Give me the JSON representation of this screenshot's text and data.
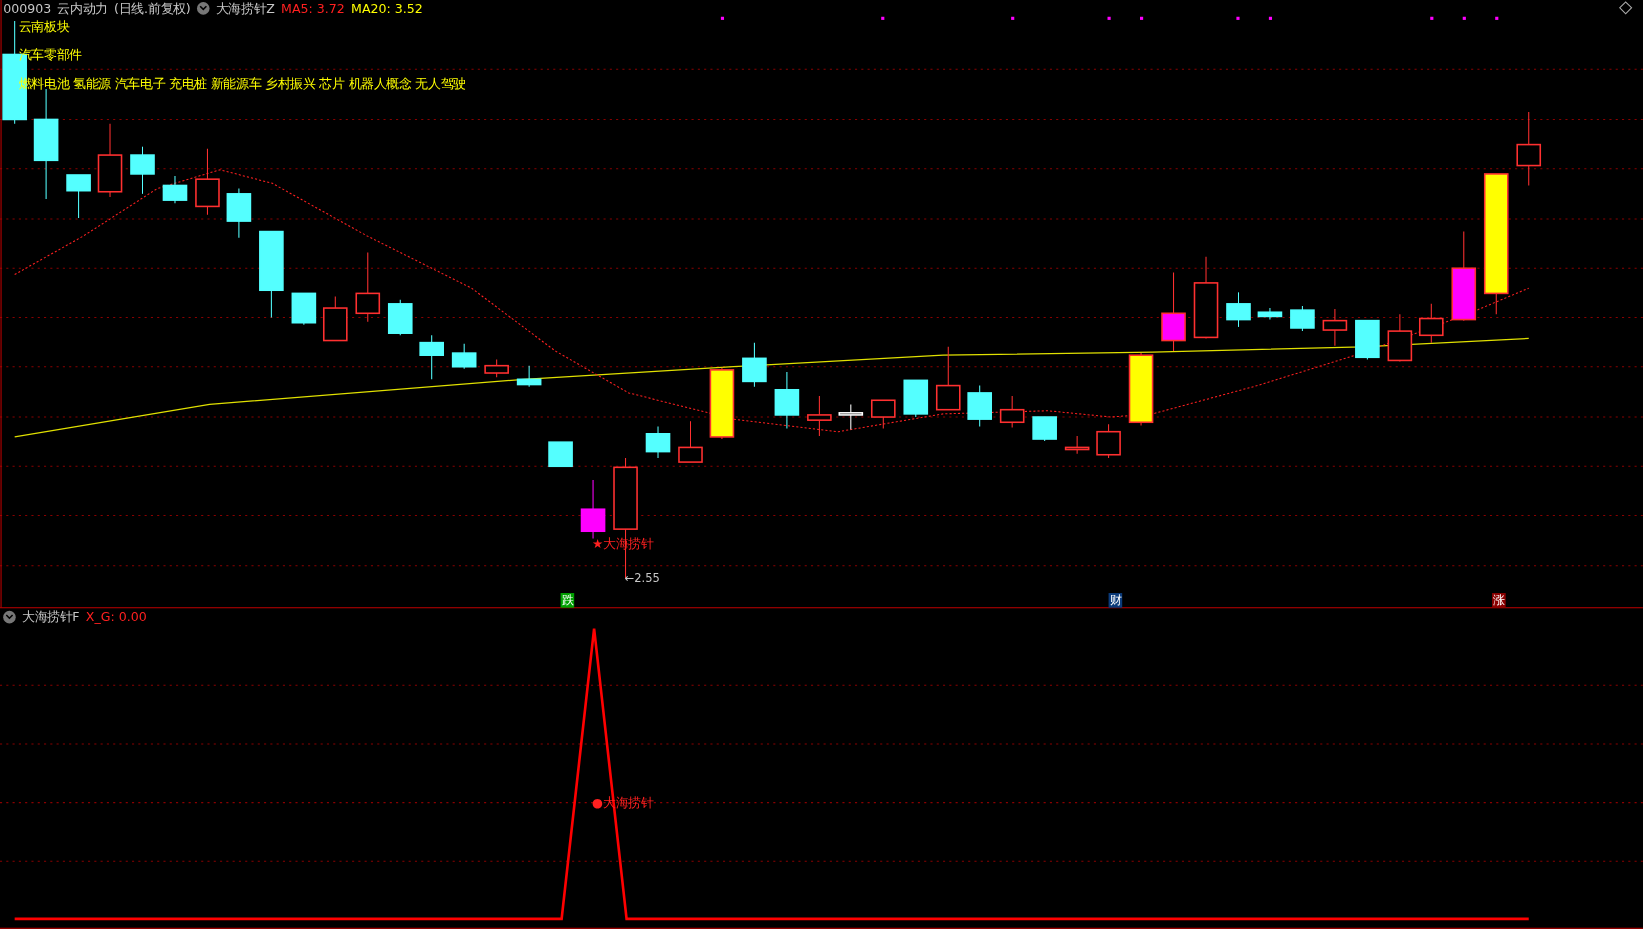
{
  "header": {
    "code": "000903",
    "name": "云内动力",
    "period": "(日线.前复权)",
    "indicator": "大海捞针Z",
    "ma5": "MA5: 3.72",
    "ma20": "MA20: 3.52"
  },
  "concepts": [
    "云南板块",
    "汽车零部件",
    "燃料电池 氢能源 汽车电子 充电桩 新能源车 乡村振兴 芯片 机器人概念 无人驾驶"
  ],
  "signal": {
    "label": "★大海捞针",
    "low": "←2.55"
  },
  "markers": [
    {
      "text": "跌",
      "color": "#00a000"
    },
    {
      "text": "财",
      "color": "#0a3a7a"
    },
    {
      "text": "涨",
      "color": "#8a0000"
    }
  ],
  "lower": {
    "indicator": "大海捞针F",
    "value": "X_G: 0.00",
    "dot_label": "●大海捞针"
  }
}
